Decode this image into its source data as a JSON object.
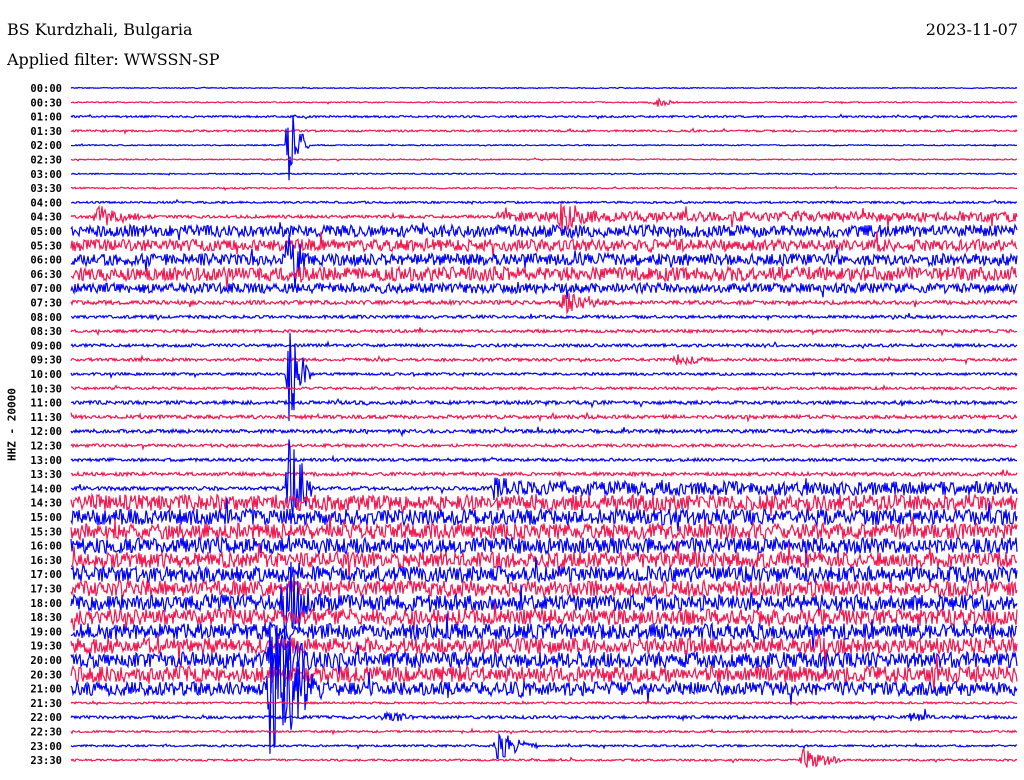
{
  "header": {
    "station": "BS Kurdzhali, Bulgaria",
    "filter": "Applied filter: WWSSN-SP",
    "date": "2023-11-07"
  },
  "chart_data": {
    "type": "line",
    "title": "BS Kurdzhali, Bulgaria",
    "subtitle": "Applied filter: WWSSN-SP",
    "date": "2023-11-07",
    "ylabel": "HHZ - 20000",
    "minutes_per_line": 30,
    "colors": [
      "#0000ff",
      "#f5174f"
    ],
    "rows": [
      {
        "t": "00:00",
        "noise": 0.5
      },
      {
        "t": "00:30",
        "noise": 0.6
      },
      {
        "t": "01:00",
        "noise": 1
      },
      {
        "t": "01:30",
        "noise": 1
      },
      {
        "t": "02:00",
        "noise": 0.6
      },
      {
        "t": "02:30",
        "noise": 0.6
      },
      {
        "t": "03:00",
        "noise": 0.6
      },
      {
        "t": "03:30",
        "noise": 0.7
      },
      {
        "t": "04:00",
        "noise": 1
      },
      {
        "t": "04:30",
        "noise": 1.5
      },
      {
        "t": "05:00",
        "noise": 6
      },
      {
        "t": "05:30",
        "noise": 6
      },
      {
        "t": "06:00",
        "noise": 6
      },
      {
        "t": "06:30",
        "noise": 7
      },
      {
        "t": "07:00",
        "noise": 5
      },
      {
        "t": "07:30",
        "noise": 2
      },
      {
        "t": "08:00",
        "noise": 1.5
      },
      {
        "t": "08:30",
        "noise": 1.5
      },
      {
        "t": "09:00",
        "noise": 1.5
      },
      {
        "t": "09:30",
        "noise": 1.5
      },
      {
        "t": "10:00",
        "noise": 1.3
      },
      {
        "t": "10:30",
        "noise": 1.3
      },
      {
        "t": "11:00",
        "noise": 1.8
      },
      {
        "t": "11:30",
        "noise": 1.8
      },
      {
        "t": "12:00",
        "noise": 1.8
      },
      {
        "t": "12:30",
        "noise": 1.5
      },
      {
        "t": "13:00",
        "noise": 1.5
      },
      {
        "t": "13:30",
        "noise": 1.8
      },
      {
        "t": "14:00",
        "noise": 2
      },
      {
        "t": "14:30",
        "noise": 8
      },
      {
        "t": "15:00",
        "noise": 8
      },
      {
        "t": "15:30",
        "noise": 8
      },
      {
        "t": "16:00",
        "noise": 8
      },
      {
        "t": "16:30",
        "noise": 8
      },
      {
        "t": "17:00",
        "noise": 8
      },
      {
        "t": "17:30",
        "noise": 8
      },
      {
        "t": "18:00",
        "noise": 8
      },
      {
        "t": "18:30",
        "noise": 8
      },
      {
        "t": "19:00",
        "noise": 8
      },
      {
        "t": "19:30",
        "noise": 8
      },
      {
        "t": "20:00",
        "noise": 8
      },
      {
        "t": "20:30",
        "noise": 8
      },
      {
        "t": "21:00",
        "noise": 7
      },
      {
        "t": "21:30",
        "noise": 1
      },
      {
        "t": "22:00",
        "noise": 1.5
      },
      {
        "t": "22:30",
        "noise": 1
      },
      {
        "t": "23:00",
        "noise": 1
      },
      {
        "t": "23:30",
        "noise": 1
      }
    ],
    "segments": [
      {
        "row": 9,
        "from": 13.5,
        "to": 30,
        "noise": 5
      },
      {
        "row": 28,
        "from": 13.5,
        "to": 30,
        "noise": 7
      }
    ],
    "events": [
      {
        "row": 1,
        "min": 18.4,
        "dur": 0.3,
        "amp": 6
      },
      {
        "row": 9,
        "min": 0.8,
        "dur": 1.2,
        "amp": 12
      },
      {
        "row": 9,
        "min": 15.5,
        "dur": 1.2,
        "amp": 16
      },
      {
        "row": 15,
        "min": 15.6,
        "dur": 1.2,
        "amp": 12
      },
      {
        "row": 19,
        "min": 19.2,
        "dur": 0.8,
        "amp": 7
      },
      {
        "row": 28,
        "min": 13.4,
        "dur": 2,
        "amp": 12
      },
      {
        "row": 29,
        "min": 14.6,
        "dur": 0.5,
        "amp": 10
      },
      {
        "row": 4,
        "min": 6.9,
        "dur": 0.05,
        "amp": 40
      },
      {
        "row": 12,
        "min": 6.9,
        "dur": 0.1,
        "amp": 40
      },
      {
        "row": 20,
        "min": 6.9,
        "dur": 0.15,
        "amp": 50
      },
      {
        "row": 28,
        "min": 6.9,
        "dur": 0.2,
        "amp": 60
      },
      {
        "row": 36,
        "min": 6.7,
        "dur": 0.6,
        "amp": 60
      },
      {
        "row": 40,
        "min": 6.3,
        "dur": 1.2,
        "amp": 40
      },
      {
        "row": 42,
        "min": 6.3,
        "dur": 1.2,
        "amp": 75
      },
      {
        "row": 42,
        "min": 14.2,
        "dur": 0.8,
        "amp": 12
      },
      {
        "row": 44,
        "min": 9.9,
        "dur": 0.8,
        "amp": 6
      },
      {
        "row": 44,
        "min": 26.6,
        "dur": 0.5,
        "amp": 6
      },
      {
        "row": 46,
        "min": 13.5,
        "dur": 0.7,
        "amp": 15
      },
      {
        "row": 47,
        "min": 23.2,
        "dur": 0.8,
        "amp": 12
      }
    ]
  }
}
